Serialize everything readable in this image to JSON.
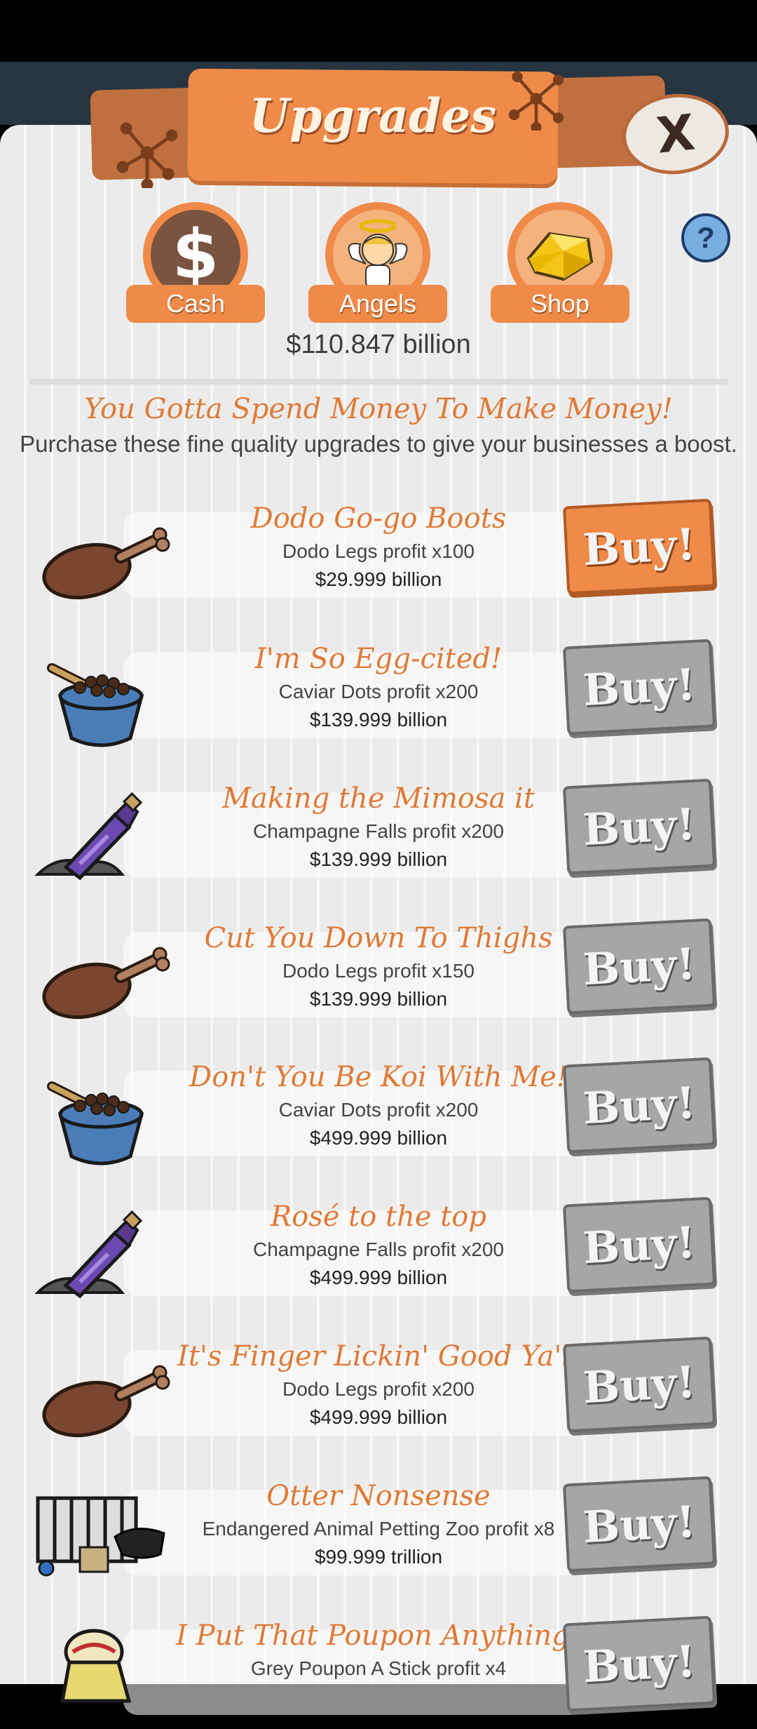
{
  "header": {
    "title": "Upgrades",
    "close_label": "X",
    "help_label": "?"
  },
  "tabs": [
    {
      "label": "Cash",
      "icon": "dollar-icon"
    },
    {
      "label": "Angels",
      "icon": "angel-icon"
    },
    {
      "label": "Shop",
      "icon": "gold-icon"
    }
  ],
  "balance": "$110.847 billion",
  "tagline": "You Gotta Spend Money To Make Money!",
  "subtitle": "Purchase these fine quality upgrades to give your businesses a boost.",
  "upgrades": [
    {
      "name": "Dodo Go-go Boots",
      "effect": "Dodo Legs profit x100",
      "price": "$29.999 billion",
      "icon": "drumstick-icon",
      "buy_label": "Buy!",
      "affordable": true
    },
    {
      "name": "I'm So Egg-cited!",
      "effect": "Caviar Dots profit x200",
      "price": "$139.999 billion",
      "icon": "caviar-icon",
      "buy_label": "Buy!",
      "affordable": false
    },
    {
      "name": "Making the Mimosa it",
      "effect": "Champagne Falls profit x200",
      "price": "$139.999 billion",
      "icon": "champagne-icon",
      "buy_label": "Buy!",
      "affordable": false
    },
    {
      "name": "Cut You Down To Thighs",
      "effect": "Dodo Legs profit x150",
      "price": "$139.999 billion",
      "icon": "drumstick-icon",
      "buy_label": "Buy!",
      "affordable": false
    },
    {
      "name": "Don't You Be Koi With Me!",
      "effect": "Caviar Dots profit x200",
      "price": "$499.999 billion",
      "icon": "caviar-icon",
      "buy_label": "Buy!",
      "affordable": false
    },
    {
      "name": "Rosé to the top",
      "effect": "Champagne Falls profit x200",
      "price": "$499.999 billion",
      "icon": "champagne-icon",
      "buy_label": "Buy!",
      "affordable": false
    },
    {
      "name": "It's Finger Lickin' Good Ya'll",
      "effect": "Dodo Legs profit x200",
      "price": "$499.999 billion",
      "icon": "drumstick-icon",
      "buy_label": "Buy!",
      "affordable": false
    },
    {
      "name": "Otter Nonsense",
      "effect": "Endangered Animal Petting Zoo profit x8",
      "price": "$99.999 trillion",
      "icon": "zoo-icon",
      "buy_label": "Buy!",
      "affordable": false
    },
    {
      "name": "I Put That Poupon Anything!",
      "effect": "Grey Poupon A Stick profit x4",
      "price": "",
      "icon": "mustard-icon",
      "buy_label": "Buy!",
      "affordable": false
    }
  ]
}
